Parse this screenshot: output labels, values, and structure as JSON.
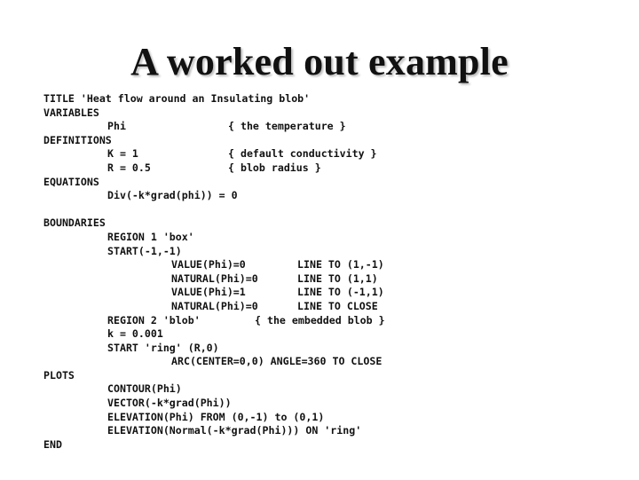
{
  "slide": {
    "title": "A worked out example"
  },
  "code": {
    "title_line": "TITLE 'Heat flow around an Insulating blob'",
    "variables_kw": "VARIABLES",
    "variables": [
      {
        "name": "Phi",
        "comment": "{ the temperature }"
      }
    ],
    "definitions_kw": "DEFINITIONS",
    "definitions": [
      {
        "expr": "K = 1",
        "comment": "{ default conductivity }"
      },
      {
        "expr": "R = 0.5",
        "comment": "{ blob radius }"
      }
    ],
    "equations_kw": "EQUATIONS",
    "equation": "Div(-k*grad(phi)) = 0",
    "boundaries_kw": "BOUNDARIES",
    "region1": "REGION 1 'box'",
    "start1": "START(-1,-1)",
    "box_segments": [
      {
        "cond": "VALUE(Phi)=0",
        "path": "LINE TO (1,-1)"
      },
      {
        "cond": "NATURAL(Phi)=0",
        "path": "LINE TO (1,1)"
      },
      {
        "cond": "VALUE(Phi)=1",
        "path": "LINE TO (-1,1)"
      },
      {
        "cond": "NATURAL(Phi)=0",
        "path": "LINE TO CLOSE"
      }
    ],
    "region2": "REGION 2 'blob'",
    "region2_comment": "{ the embedded blob }",
    "region2_k": "k = 0.001",
    "start2": "START 'ring' (R,0)",
    "arc": "ARC(CENTER=0,0) ANGLE=360 TO CLOSE",
    "plots_kw": "PLOTS",
    "plots": [
      "CONTOUR(Phi)",
      "VECTOR(-k*grad(Phi))",
      "ELEVATION(Phi) FROM (0,-1) to (0,1)",
      "ELEVATION(Normal(-k*grad(Phi))) ON 'ring'"
    ],
    "end_kw": "END"
  }
}
